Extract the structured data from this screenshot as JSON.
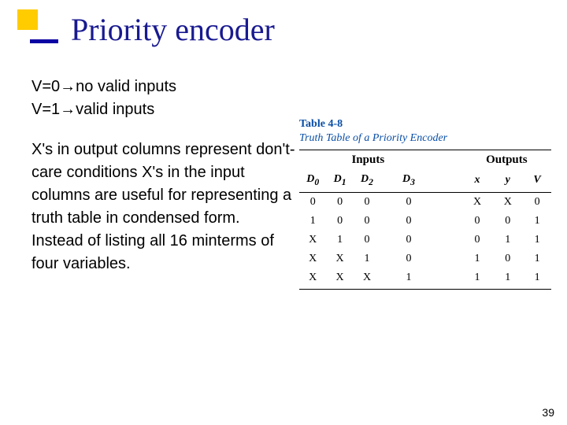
{
  "slide": {
    "title": "Priority encoder",
    "bullets": {
      "line1": "V=0→no valid inputs",
      "line2": "V=1→valid inputs",
      "para": "X's in output columns represent don't-care conditions X's in the input columns are useful for representing a truth table in condensed form. Instead of listing all 16 minterms of four variables."
    },
    "page_number": "39"
  },
  "table": {
    "ref": "Table 4-8",
    "caption": "Truth Table of a Priority Encoder",
    "group_headers": [
      "Inputs",
      "Outputs"
    ],
    "input_cols": [
      "D0",
      "D1",
      "D2",
      "D3"
    ],
    "output_cols": [
      "x",
      "y",
      "V"
    ],
    "rows": [
      {
        "in": [
          "0",
          "0",
          "0",
          "0"
        ],
        "out": [
          "X",
          "X",
          "0"
        ]
      },
      {
        "in": [
          "1",
          "0",
          "0",
          "0"
        ],
        "out": [
          "0",
          "0",
          "1"
        ]
      },
      {
        "in": [
          "X",
          "1",
          "0",
          "0"
        ],
        "out": [
          "0",
          "1",
          "1"
        ]
      },
      {
        "in": [
          "X",
          "X",
          "1",
          "0"
        ],
        "out": [
          "1",
          "0",
          "1"
        ]
      },
      {
        "in": [
          "X",
          "X",
          "X",
          "1"
        ],
        "out": [
          "1",
          "1",
          "1"
        ]
      }
    ]
  },
  "chart_data": {
    "type": "table",
    "title": "Table 4-8 Truth Table of a Priority Encoder",
    "columns": [
      "D0",
      "D1",
      "D2",
      "D3",
      "x",
      "y",
      "V"
    ],
    "rows": [
      [
        "0",
        "0",
        "0",
        "0",
        "X",
        "X",
        "0"
      ],
      [
        "1",
        "0",
        "0",
        "0",
        "0",
        "0",
        "1"
      ],
      [
        "X",
        "1",
        "0",
        "0",
        "0",
        "1",
        "1"
      ],
      [
        "X",
        "X",
        "1",
        "0",
        "1",
        "0",
        "1"
      ],
      [
        "X",
        "X",
        "X",
        "1",
        "1",
        "1",
        "1"
      ]
    ]
  }
}
